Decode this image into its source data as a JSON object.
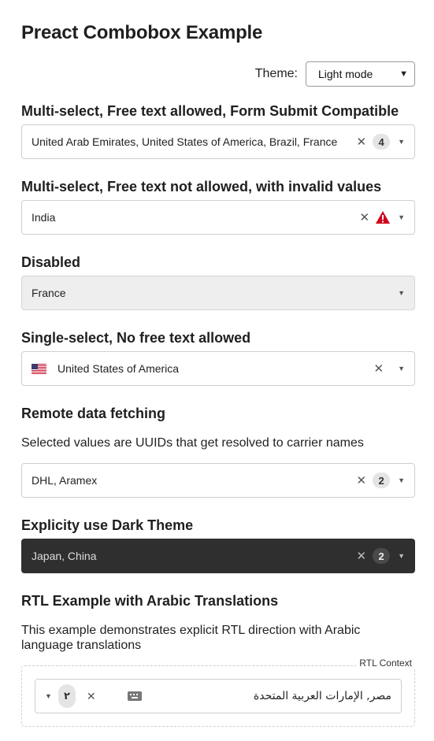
{
  "page_title": "Preact Combobox Example",
  "theme": {
    "label": "Theme:",
    "selected": "Light mode"
  },
  "sections": [
    {
      "title": "Multi-select, Free text allowed, Form Submit Compatible",
      "value": "United Arab Emirates, United States of America, Brazil, France",
      "count": "4"
    },
    {
      "title": "Multi-select, Free text not allowed, with invalid values",
      "value": "India"
    },
    {
      "title": "Disabled",
      "value": "France"
    },
    {
      "title": "Single-select, No free text allowed",
      "value": "United States of America"
    },
    {
      "title": "Remote data fetching",
      "description": "Selected values are UUIDs that get resolved to carrier names",
      "value": "DHL, Aramex",
      "count": "2"
    },
    {
      "title": "Explicity use Dark Theme",
      "value": "Japan, China",
      "count": "2"
    },
    {
      "title": "RTL Example with Arabic Translations",
      "description": "This example demonstrates explicit RTL direction with Arabic language translations",
      "context_label": "RTL Context",
      "value": "مصر, الإمارات العربية المتحدة",
      "count": "٢"
    }
  ],
  "icons": {
    "clear": "close-icon",
    "caret": "chevron-down-icon",
    "warning": "warning-icon",
    "flag": "us-flag-icon",
    "keyboard": "keyboard-icon"
  },
  "colors": {
    "warning": "#d0021b",
    "dark_bg": "#2f2f2f"
  }
}
